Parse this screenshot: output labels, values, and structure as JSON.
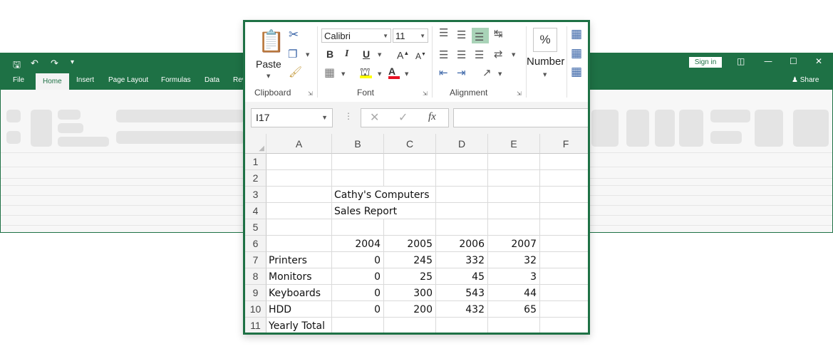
{
  "background_window": {
    "tabs": [
      "File",
      "Home",
      "Insert",
      "Page Layout",
      "Formulas",
      "Data",
      "Rev"
    ],
    "active_tab": "Home",
    "sign_in_label": "Sign in",
    "share_label": "Share"
  },
  "ribbon": {
    "clipboard": {
      "paste_label": "Paste",
      "group_label": "Clipboard"
    },
    "font": {
      "font_name": "Calibri",
      "font_size": "11",
      "group_label": "Font",
      "bold": "B",
      "italic": "I",
      "underline": "U"
    },
    "alignment": {
      "group_label": "Alignment"
    },
    "number": {
      "format_label": "Number",
      "percent": "%"
    }
  },
  "formula_bar": {
    "name_box": "I17",
    "fx_label": "fx",
    "formula": ""
  },
  "sheet": {
    "columns": [
      "A",
      "B",
      "C",
      "D",
      "E",
      "F"
    ],
    "rows": [
      "1",
      "2",
      "3",
      "4",
      "5",
      "6",
      "7",
      "8",
      "9",
      "10",
      "11"
    ],
    "cells": {
      "B3": "Cathy's Computers",
      "B4": "Sales Report",
      "B6": "2004",
      "C6": "2005",
      "D6": "2006",
      "E6": "2007",
      "A7": "Printers",
      "B7": "0",
      "C7": "245",
      "D7": "332",
      "E7": "32",
      "A8": "Monitors",
      "B8": "0",
      "C8": "25",
      "D8": "45",
      "E8": "3",
      "A9": "Keyboards",
      "B9": "0",
      "C9": "300",
      "D9": "543",
      "E9": "44",
      "A10": "HDD",
      "B10": "0",
      "C10": "200",
      "D10": "432",
      "E10": "65",
      "A11": "Yearly Total"
    }
  },
  "colors": {
    "excel_green": "#1e7145",
    "selected_align": "#a9d3b8"
  }
}
